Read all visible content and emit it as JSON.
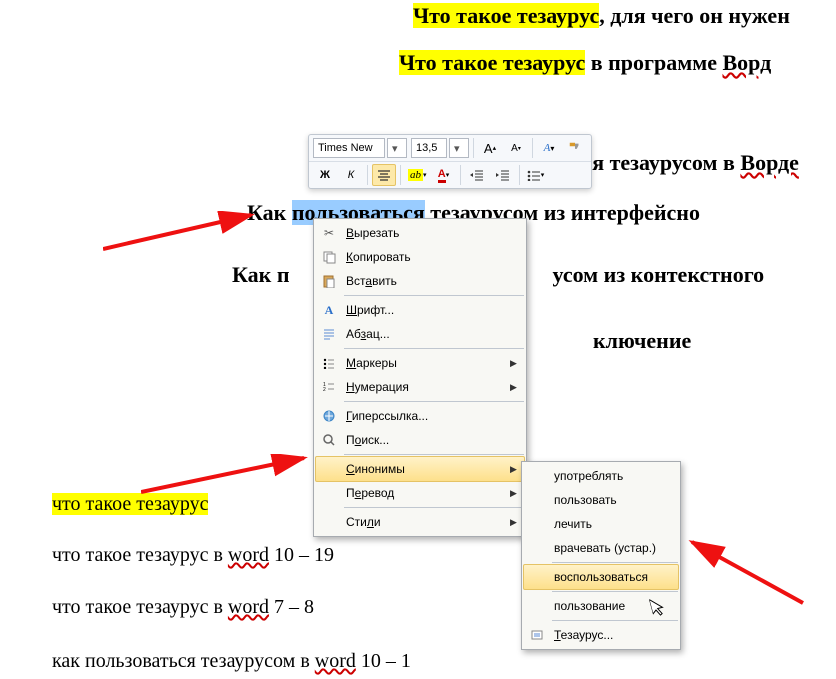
{
  "doc": {
    "l1a": "Что такое тезаурус",
    "l1b": ", для чего он нужен",
    "l2a": "Что такое тезаурус",
    "l2b": " в программе ",
    "l2c": "Ворд",
    "l3b": "ться тезаурусом в ",
    "l3c": "Ворде",
    "l4a": "Как ",
    "l4b": "пользоваться",
    "l4c": " тезаурусом из интерфейсно",
    "l5a": "Как п",
    "l5b": "усом из контекстного",
    "l6": "ключение",
    "l7a": "что такое тезаурус",
    "l8": "что такое тезаурус в ",
    "l8w": "word",
    "l8n": "     10 – 19",
    "l9": "что такое тезаурус в ",
    "l9w": "word",
    "l9n": "   7 – 8",
    "l10": "как пользоваться тезаурусом в ",
    "l10w": "word",
    "l10n": "    10 – 1"
  },
  "toolbar": {
    "font": "Times New",
    "size": "13,5",
    "bold": "Ж",
    "italic": "К"
  },
  "ctx": {
    "cut": "Вырезать",
    "copy": "Копировать",
    "paste": "Вставить",
    "font": "Шрифт...",
    "para": "Абзац...",
    "bullets": "Маркеры",
    "numbering": "Нумерация",
    "link": "Гиперссылка...",
    "find": "Поиск...",
    "syn": "Синонимы",
    "trans": "Перевод",
    "styles": "Стили"
  },
  "sub": {
    "s1": "употреблять",
    "s2": "пользовать",
    "s3": "лечить",
    "s4": "врачевать (устар.)",
    "s5": "воспользоваться",
    "s6": "пользование",
    "s7": "Тезаурус..."
  }
}
